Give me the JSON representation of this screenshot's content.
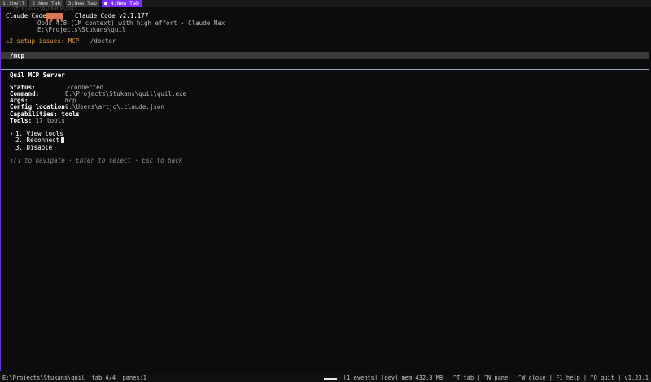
{
  "tabs": [
    {
      "label": "1:Shell",
      "active": false
    },
    {
      "label": "2:New Tab",
      "active": false
    },
    {
      "label": "3:New Tab",
      "active": false
    },
    {
      "label": "● 4:New Tab",
      "active": true
    }
  ],
  "faint_path": ":\\Projects\\Stukans\\quil",
  "header": {
    "app_name": "Claude Code",
    "app_version": "Claude Code v2.1.177",
    "model_line": "Opus 4.8 (1M context) with high effort · Claude Max",
    "cwd": "E:\\Projects\\Stukans\\quil"
  },
  "warning": {
    "prefix": "⚠2 setup issues: MCP",
    "suffix": " · /doctor"
  },
  "command": "/mcp",
  "server": {
    "title": "Quil MCP Server",
    "fields": [
      {
        "label": "Status:",
        "value": "connected",
        "check": "✓"
      },
      {
        "label": "Command:",
        "value": "E:\\Projects\\Stukans\\quil\\quil.exe"
      },
      {
        "label": "Args:",
        "value": "mcp"
      },
      {
        "label": "Config location:",
        "value": "C:\\Users\\artjo\\.claude.json"
      }
    ],
    "capabilities_label": "Capabilities:",
    "capabilities_value": "tools",
    "tools_label": "Tools:",
    "tools_value": "17 tools"
  },
  "menu": {
    "pointer": "›",
    "items": [
      "1. View tools",
      "2. Reconnect",
      "3. Disable"
    ]
  },
  "hint": "↑/↓ to navigate · Enter to select · Esc to back",
  "statusbar": {
    "left": "E:\\Projects\\Stukans\\quil  tab 4/4  panes:1",
    "right": "[1 events] [dev] mem 432.3 MB | ^T tab | ^N pane | ^W close | F1 help | ^Q quit | v1.23.1"
  },
  "colors": {
    "accent": "#7b2cff",
    "logo": "#d97757",
    "warning": "#e0a040",
    "success": "#7fd36b"
  }
}
